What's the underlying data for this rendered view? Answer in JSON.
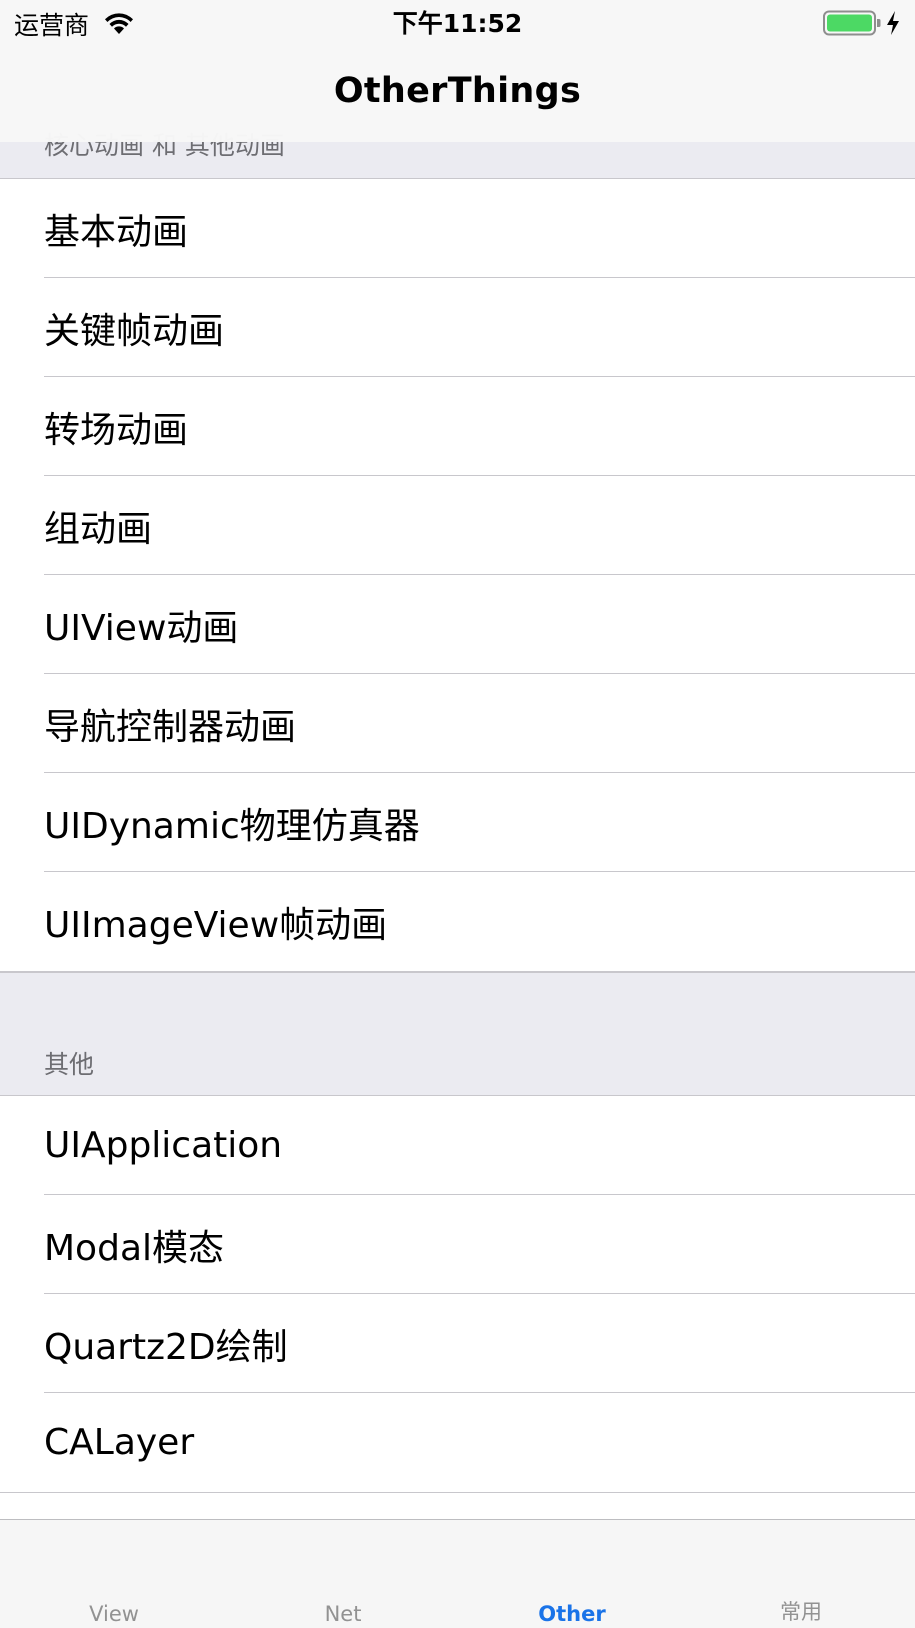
{
  "status_bar": {
    "carrier": "运营商",
    "time": "下午11:52"
  },
  "nav": {
    "title": "OtherThings"
  },
  "sections": [
    {
      "header": "核心动画 和 其他动画",
      "items": [
        "基本动画",
        "关键帧动画",
        "转场动画",
        "组动画",
        "UIView动画",
        "导航控制器动画",
        "UIDynamic物理仿真器",
        "UIImageView帧动画"
      ]
    },
    {
      "header": "其他",
      "items": [
        "UIApplication",
        "Modal模态",
        "Quartz2D绘制",
        "CALayer"
      ]
    }
  ],
  "tab_bar": {
    "tabs": [
      {
        "label": "View",
        "active": false
      },
      {
        "label": "Net",
        "active": false
      },
      {
        "label": "Other",
        "active": true
      },
      {
        "label": "常用",
        "active": false
      }
    ],
    "accent_color": "#1a73e8"
  }
}
